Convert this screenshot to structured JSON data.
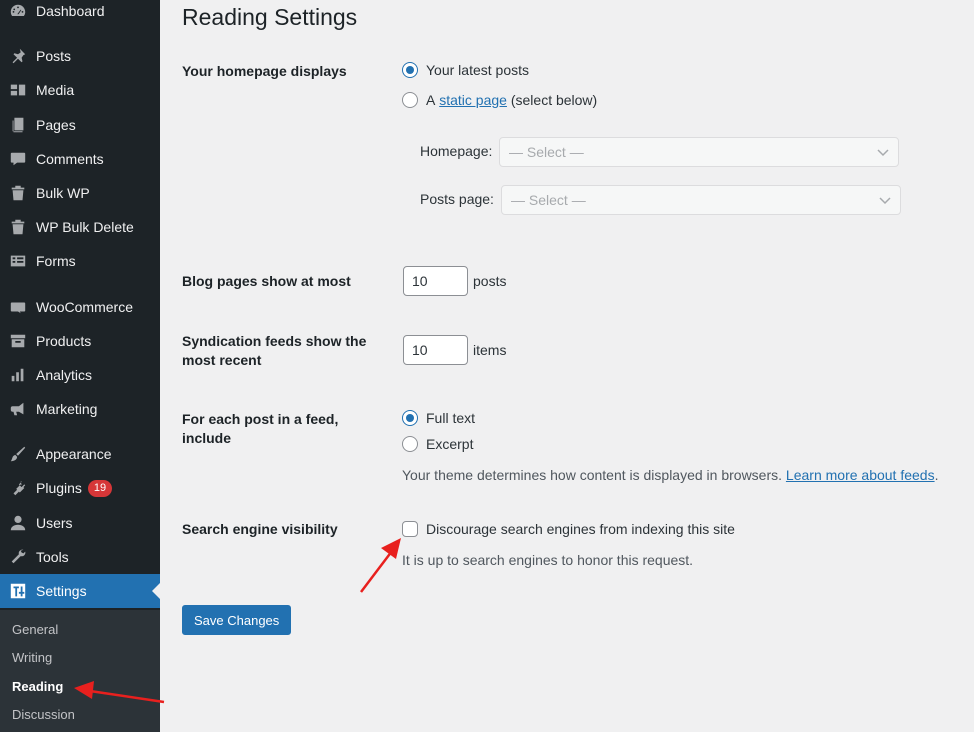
{
  "sidebar": {
    "items": [
      {
        "label": "Dashboard",
        "icon": "dashboard-icon"
      },
      {
        "label": "Posts",
        "icon": "pushpin-icon"
      },
      {
        "label": "Media",
        "icon": "media-icon"
      },
      {
        "label": "Pages",
        "icon": "pages-icon"
      },
      {
        "label": "Comments",
        "icon": "comment-icon"
      },
      {
        "label": "Bulk WP",
        "icon": "trash-icon"
      },
      {
        "label": "WP Bulk Delete",
        "icon": "trash-icon"
      },
      {
        "label": "Forms",
        "icon": "forms-icon"
      },
      {
        "label": "WooCommerce",
        "icon": "woo-icon"
      },
      {
        "label": "Products",
        "icon": "archive-icon"
      },
      {
        "label": "Analytics",
        "icon": "bar-chart-icon"
      },
      {
        "label": "Marketing",
        "icon": "megaphone-icon"
      },
      {
        "label": "Appearance",
        "icon": "paintbrush-icon"
      },
      {
        "label": "Plugins",
        "icon": "plugin-icon",
        "badge": "19"
      },
      {
        "label": "Users",
        "icon": "user-icon"
      },
      {
        "label": "Tools",
        "icon": "wrench-icon"
      },
      {
        "label": "Settings",
        "icon": "settings-sliders-icon"
      }
    ],
    "submenu": [
      "General",
      "Writing",
      "Reading",
      "Discussion"
    ]
  },
  "page": {
    "title": "Reading Settings",
    "homepage": {
      "label": "Your homepage displays",
      "option_latest": "Your latest posts",
      "option_static_prefix": "A",
      "option_static_link": "static page",
      "option_static_suffix": "(select below)",
      "homepage_label": "Homepage:",
      "homepage_value": "— Select —",
      "posts_page_label": "Posts page:",
      "posts_page_value": "— Select —"
    },
    "blog_pages": {
      "label": "Blog pages show at most",
      "value": "10",
      "unit": "posts"
    },
    "feeds": {
      "label": "Syndication feeds show the most recent",
      "value": "10",
      "unit": "items"
    },
    "feed_content": {
      "label": "For each post in a feed, include",
      "option_full": "Full text",
      "option_excerpt": "Excerpt",
      "desc_prefix": "Your theme determines how content is displayed in browsers.",
      "desc_link": "Learn more about feeds",
      "desc_suffix": "."
    },
    "visibility": {
      "label": "Search engine visibility",
      "checkbox_label": "Discourage search engines from indexing this site",
      "note": "It is up to search engines to honor this request."
    },
    "save_label": "Save Changes"
  },
  "colors": {
    "accent": "#2271b1",
    "sidebar": "#1d2327",
    "annotation_arrow": "#e8201e"
  }
}
